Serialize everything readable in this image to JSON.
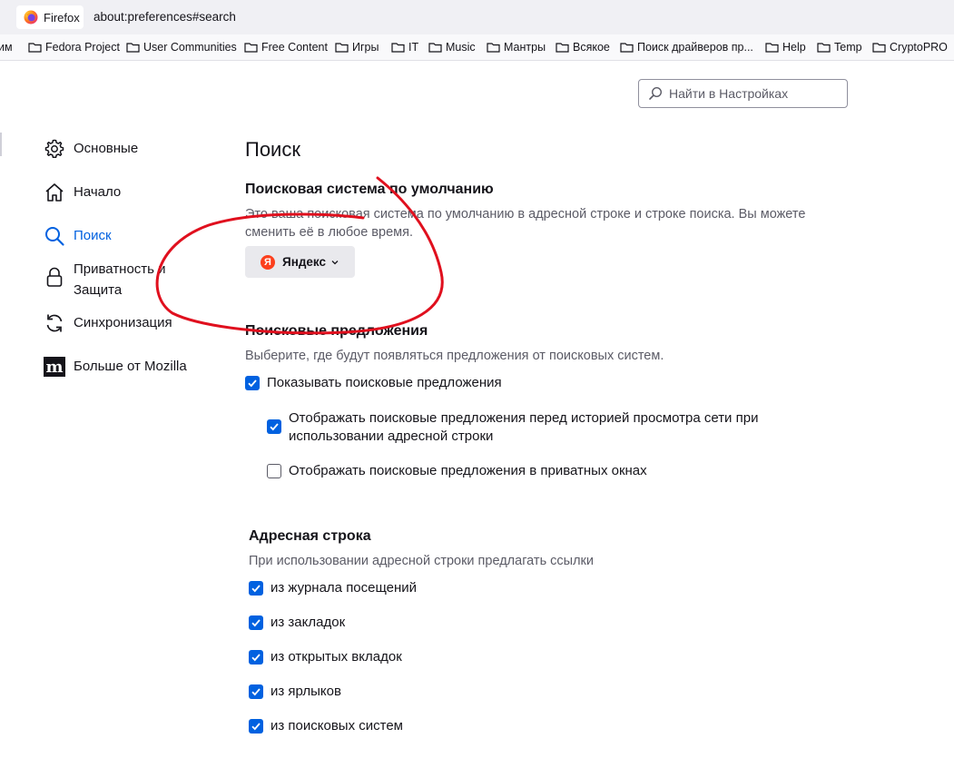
{
  "browser": {
    "identity_label": "Firefox",
    "url": "about:preferences#search",
    "bookmarks": [
      {
        "label": "им"
      },
      {
        "label": "Fedora Project"
      },
      {
        "label": "User Communities"
      },
      {
        "label": "Free Content"
      },
      {
        "label": "Игры"
      },
      {
        "label": "IT"
      },
      {
        "label": "Music"
      },
      {
        "label": "Мантры"
      },
      {
        "label": "Всякое"
      },
      {
        "label": "Поиск драйверов пр..."
      },
      {
        "label": "Help"
      },
      {
        "label": "Temp"
      },
      {
        "label": "CryptoPRO"
      }
    ]
  },
  "search_box": {
    "placeholder": "Найти в Настройках"
  },
  "sidebar": {
    "items": [
      {
        "label": "Основные",
        "icon": "gear-icon"
      },
      {
        "label": "Начало",
        "icon": "home-icon"
      },
      {
        "label": "Поиск",
        "icon": "search-icon",
        "selected": true
      },
      {
        "label_line1": "Приватность и",
        "label_line2": "Защита",
        "icon": "lock-icon"
      },
      {
        "label": "Синхронизация",
        "icon": "sync-icon"
      },
      {
        "label": "Больше от Mozilla",
        "icon": "mozilla-logo-icon"
      }
    ]
  },
  "main": {
    "title": "Поиск",
    "default_engine": {
      "heading": "Поисковая система по умолчанию",
      "description_line1": "Это ваша поисковая система по умолчанию в адресной строке и строке поиска. Вы можете",
      "description_line2": "сменить её в любое время.",
      "selected_engine": "Яндекс",
      "engine_logo_letter": "Я"
    },
    "suggestions": {
      "heading": "Поисковые предложения",
      "description": "Выберите, где будут появляться предложения от поисковых систем.",
      "show_suggestions": {
        "label": "Показывать поисковые предложения",
        "checked": true
      },
      "before_history": {
        "label_line1": "Отображать поисковые предложения перед историей просмотра сети при",
        "label_line2": "использовании адресной строки",
        "checked": true
      },
      "in_private": {
        "label": "Отображать поисковые предложения в приватных окнах",
        "checked": false
      }
    },
    "address_bar": {
      "heading": "Адресная строка",
      "description": "При использовании адресной строки предлагать ссылки",
      "options": [
        {
          "label": "из журнала посещений",
          "checked": true
        },
        {
          "label": "из закладок",
          "checked": true
        },
        {
          "label": "из открытых вкладок",
          "checked": true
        },
        {
          "label": "из ярлыков",
          "checked": true
        },
        {
          "label": "из поисковых систем",
          "checked": true
        }
      ]
    }
  },
  "colors": {
    "accent": "#0061e0",
    "annotation": "#e0101e",
    "yandex": "#fc3f1d"
  }
}
